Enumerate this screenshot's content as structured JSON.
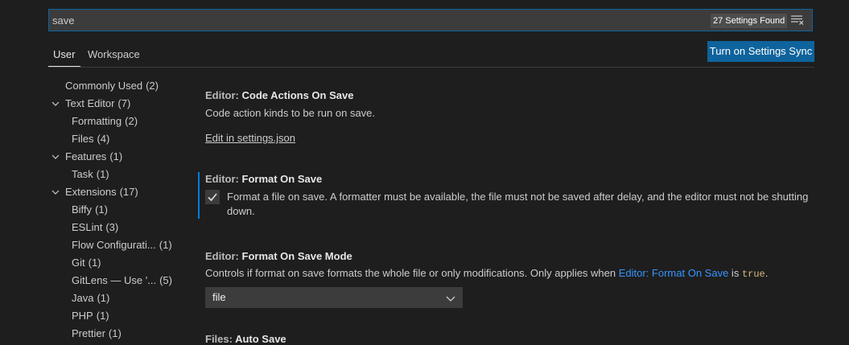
{
  "search": {
    "value": "save",
    "result_count": "27 Settings Found",
    "filter_icon": "clear-filter-icon"
  },
  "tabs": [
    {
      "label": "User",
      "active": true
    },
    {
      "label": "Workspace",
      "active": false
    }
  ],
  "sync_button": "Turn on Settings Sync",
  "toc": [
    {
      "label": "Commonly Used",
      "count": "(2)",
      "indent": 0,
      "expandable": false
    },
    {
      "label": "Text Editor",
      "count": "(7)",
      "indent": 0,
      "expandable": true
    },
    {
      "label": "Formatting",
      "count": "(2)",
      "indent": 1,
      "expandable": false
    },
    {
      "label": "Files",
      "count": "(4)",
      "indent": 1,
      "expandable": false
    },
    {
      "label": "Features",
      "count": "(1)",
      "indent": 0,
      "expandable": true
    },
    {
      "label": "Task",
      "count": "(1)",
      "indent": 1,
      "expandable": false
    },
    {
      "label": "Extensions",
      "count": "(17)",
      "indent": 0,
      "expandable": true
    },
    {
      "label": "Biffy",
      "count": "(1)",
      "indent": 1,
      "expandable": false
    },
    {
      "label": "ESLint",
      "count": "(3)",
      "indent": 1,
      "expandable": false
    },
    {
      "label": "Flow Configurati...",
      "count": "(1)",
      "indent": 1,
      "expandable": false
    },
    {
      "label": "Git",
      "count": "(1)",
      "indent": 1,
      "expandable": false
    },
    {
      "label": "GitLens — Use '...",
      "count": "(5)",
      "indent": 1,
      "expandable": false
    },
    {
      "label": "Java",
      "count": "(1)",
      "indent": 1,
      "expandable": false
    },
    {
      "label": "PHP",
      "count": "(1)",
      "indent": 1,
      "expandable": false
    },
    {
      "label": "Prettier",
      "count": "(1)",
      "indent": 1,
      "expandable": false
    }
  ],
  "settings": {
    "code_actions": {
      "category": "Editor: ",
      "name": "Code Actions On Save",
      "description": "Code action kinds to be run on save.",
      "edit_link": "Edit in settings.json"
    },
    "format_on_save": {
      "category": "Editor: ",
      "name": "Format On Save",
      "checked": true,
      "description": "Format a file on save. A formatter must be available, the file must not be saved after delay, and the editor must not be shutting down."
    },
    "format_on_save_mode": {
      "category": "Editor: ",
      "name": "Format On Save Mode",
      "description_prefix": "Controls if format on save formats the whole file or only modifications. Only applies when ",
      "description_link": "Editor: Format On Save",
      "description_mid": " is ",
      "description_code": "true",
      "description_suffix": ".",
      "selected": "file"
    },
    "auto_save": {
      "category": "Files: ",
      "name": "Auto Save"
    }
  },
  "colors": {
    "accent": "#0e639c",
    "focus_border": "#007fd4",
    "link": "#3794ff"
  }
}
